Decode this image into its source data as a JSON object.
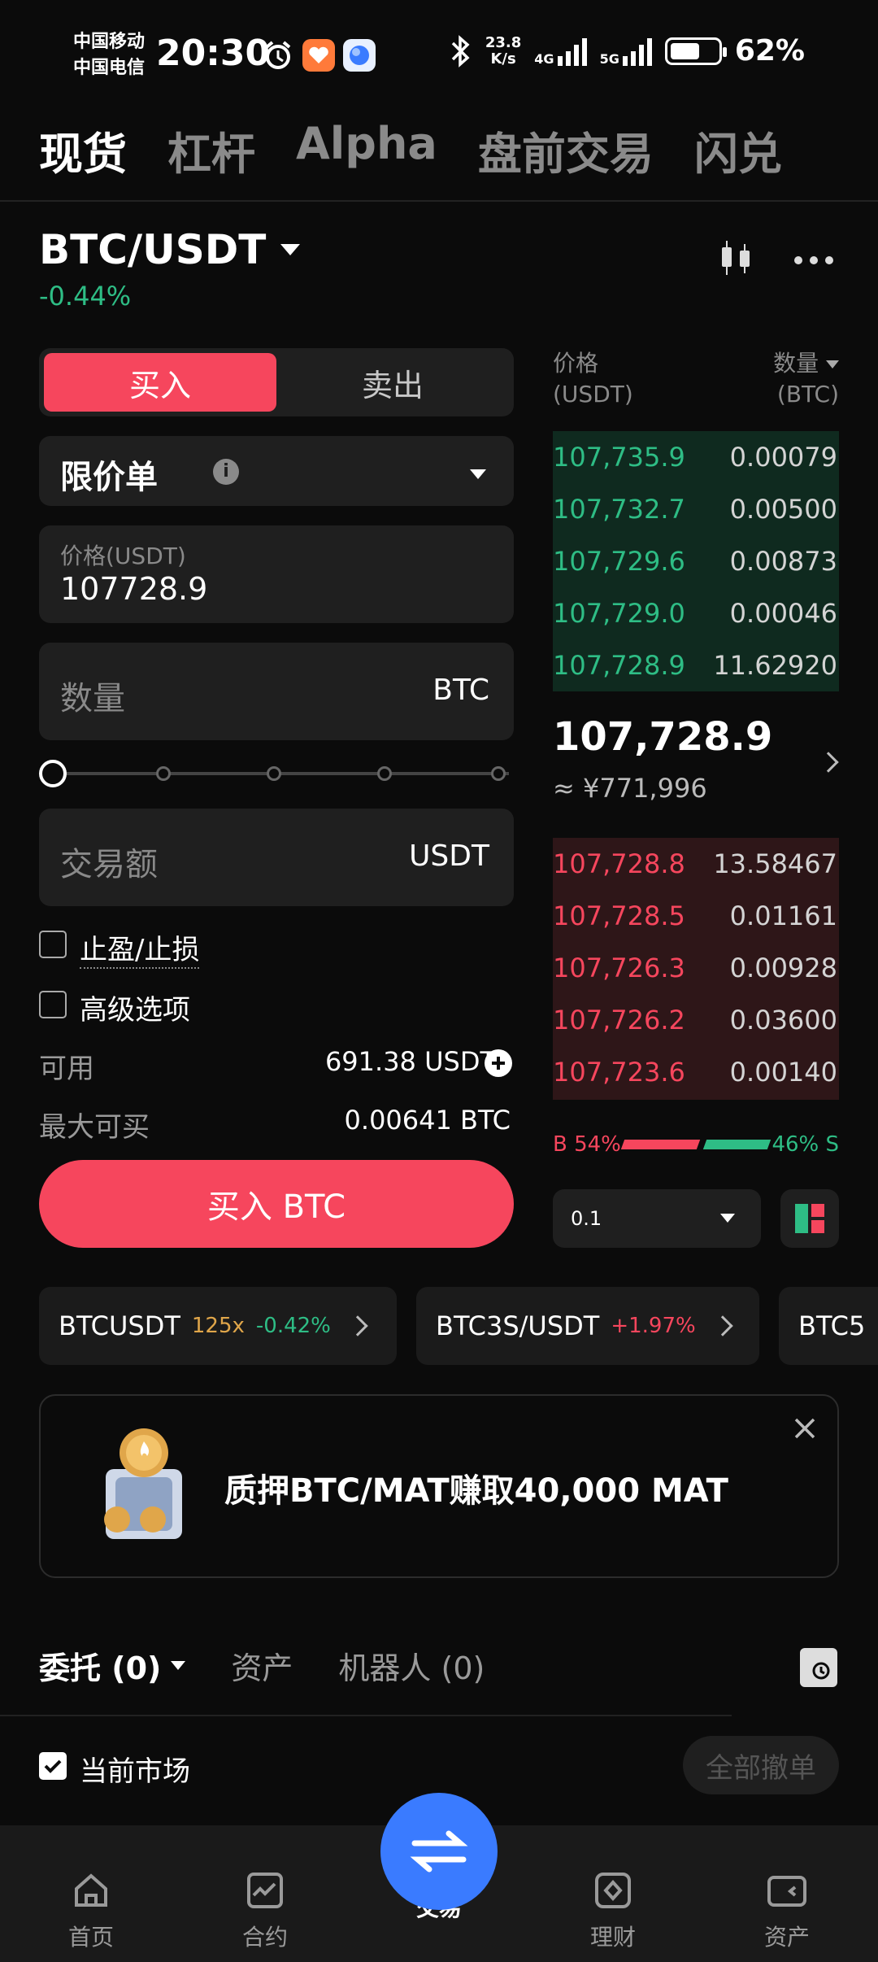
{
  "status_bar": {
    "carrier_1": "中国移动",
    "carrier_2": "中国电信",
    "time": "20:30",
    "net_speed_value": "23.8",
    "net_speed_unit": "K/s",
    "network_1": "4G",
    "network_2": "5G",
    "battery": "62%",
    "battery_level": 0.62
  },
  "top_tabs": [
    "现货",
    "杠杆",
    "Alpha",
    "盘前交易",
    "闪兑"
  ],
  "pair": {
    "symbol": "BTC/USDT",
    "change": "-0.44%"
  },
  "order_form": {
    "buy_label": "买入",
    "sell_label": "卖出",
    "order_type": "限价单",
    "price_label": "价格(USDT)",
    "price_value": "107728.9",
    "qty_placeholder": "数量",
    "qty_unit": "BTC",
    "slider_level": 0,
    "amount_placeholder": "交易额",
    "amount_unit": "USDT",
    "tp_sl_label": "止盈/止损",
    "advanced_label": "高级选项",
    "available_label": "可用",
    "available_value": "691.38 USDT",
    "max_buy_label": "最大可买",
    "max_buy_value": "0.00641 BTC",
    "submit_label": "买入 BTC"
  },
  "order_book": {
    "price_header_1": "价格",
    "price_header_2": "(USDT)",
    "qty_header_1": "数量",
    "qty_header_2": "(BTC)",
    "bids_top": [
      {
        "price": "107,735.9",
        "qty": "0.00079"
      },
      {
        "price": "107,732.7",
        "qty": "0.00500"
      },
      {
        "price": "107,729.6",
        "qty": "0.00873"
      },
      {
        "price": "107,729.0",
        "qty": "0.00046"
      },
      {
        "price": "107,728.9",
        "qty": "11.62920"
      }
    ],
    "last_price": "107,728.9",
    "last_price_cny": "≈ ¥771,996",
    "asks_bottom": [
      {
        "price": "107,728.8",
        "qty": "13.58467"
      },
      {
        "price": "107,728.5",
        "qty": "0.01161"
      },
      {
        "price": "107,726.3",
        "qty": "0.00928"
      },
      {
        "price": "107,726.2",
        "qty": "0.03600"
      },
      {
        "price": "107,723.6",
        "qty": "0.00140"
      }
    ],
    "buy_ratio_label": "B 54%",
    "sell_ratio_label": "46% S",
    "buy_ratio": 0.54,
    "precision": "0.1"
  },
  "tickers": [
    {
      "symbol": "BTCUSDT",
      "leverage": "125x",
      "change": "-0.42%"
    },
    {
      "symbol": "BTC3S/USDT",
      "change": "+1.97%"
    },
    {
      "symbol": "BTC5"
    }
  ],
  "banner": {
    "text": "质押BTC/MAT赚取40,000 MAT"
  },
  "orders": {
    "tab_orders": "委托 (0)",
    "tab_assets": "资产",
    "tab_bots": "机器人 (0)",
    "current_market_label": "当前市场",
    "cancel_all_label": "全部撤单"
  },
  "bottom_nav": [
    "首页",
    "合约",
    "交易",
    "理财",
    "资产"
  ],
  "colors": {
    "buy": "#f6465d",
    "up": "#2ebd85",
    "accent": "#3a7bff"
  }
}
